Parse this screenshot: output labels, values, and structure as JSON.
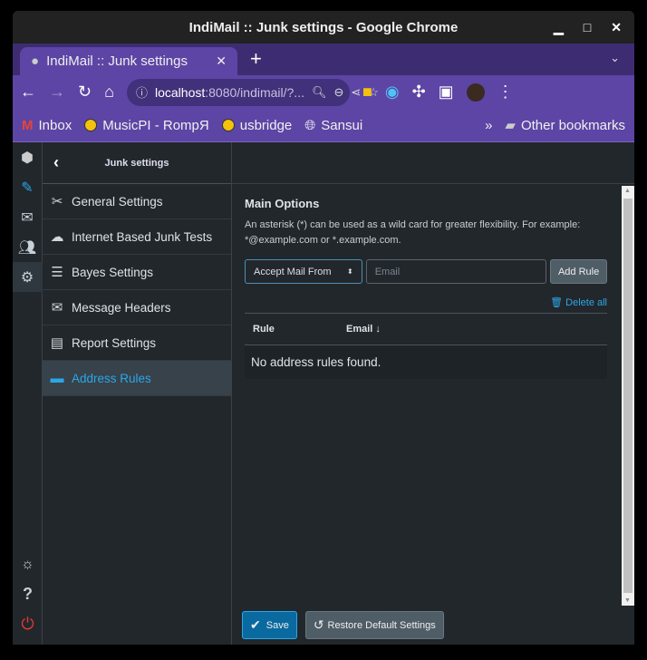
{
  "window": {
    "title": "IndiMail :: Junk settings - Google Chrome"
  },
  "browser": {
    "tab_title": "IndiMail :: Junk settings",
    "url_host": "localhost",
    "url_rest": ":8080/indimail/?...",
    "bookmarks": [
      "Inbox",
      "MusicPI - RompЯ",
      "usbridge",
      "Sansui"
    ],
    "other_bookmarks": "Other bookmarks"
  },
  "sidebar": {
    "title": "Junk settings",
    "items": [
      {
        "label": "General Settings",
        "icon": "tools-icon"
      },
      {
        "label": "Internet Based Junk Tests",
        "icon": "cloud-icon"
      },
      {
        "label": "Bayes Settings",
        "icon": "database-icon"
      },
      {
        "label": "Message Headers",
        "icon": "envelope-icon"
      },
      {
        "label": "Report Settings",
        "icon": "document-icon"
      },
      {
        "label": "Address Rules",
        "icon": "address-card-icon",
        "selected": true
      }
    ]
  },
  "main": {
    "heading": "Main Options",
    "hint": "An asterisk (*) can be used as a wild card for greater flexibility. For example: *@example.com or *.example.com.",
    "rule_select": "Accept Mail From",
    "email_placeholder": "Email",
    "add_rule": "Add Rule",
    "delete_all": "Delete all",
    "columns": [
      "Rule",
      "Email ↓"
    ],
    "empty": "No address rules found.",
    "save": "Save",
    "restore": "Restore Default Settings"
  },
  "colors": {
    "accent": "#2ba7e8",
    "browser": "#5d45a5",
    "logout": "#e53935"
  }
}
